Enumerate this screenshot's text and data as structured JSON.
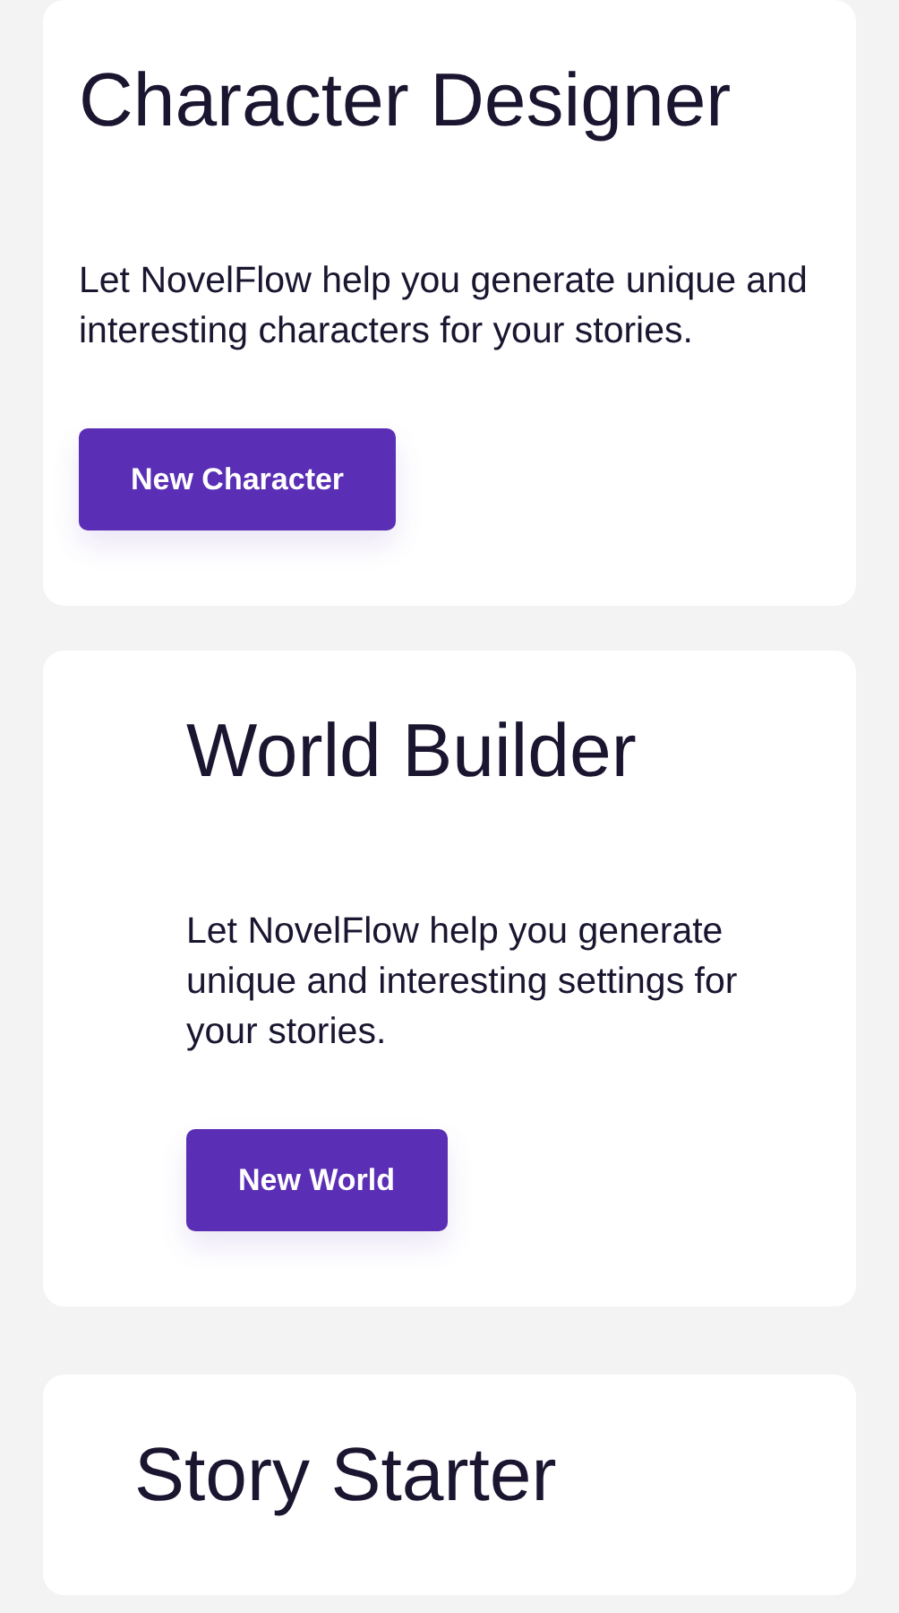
{
  "cards": [
    {
      "title": "Character Designer",
      "description": "Let NovelFlow help you generate unique and interesting characters for your stories.",
      "button": "New Character"
    },
    {
      "title": "World Builder",
      "description": "Let NovelFlow help you generate unique and interesting settings for your stories.",
      "button": "New World"
    },
    {
      "title": "Story Starter"
    }
  ]
}
